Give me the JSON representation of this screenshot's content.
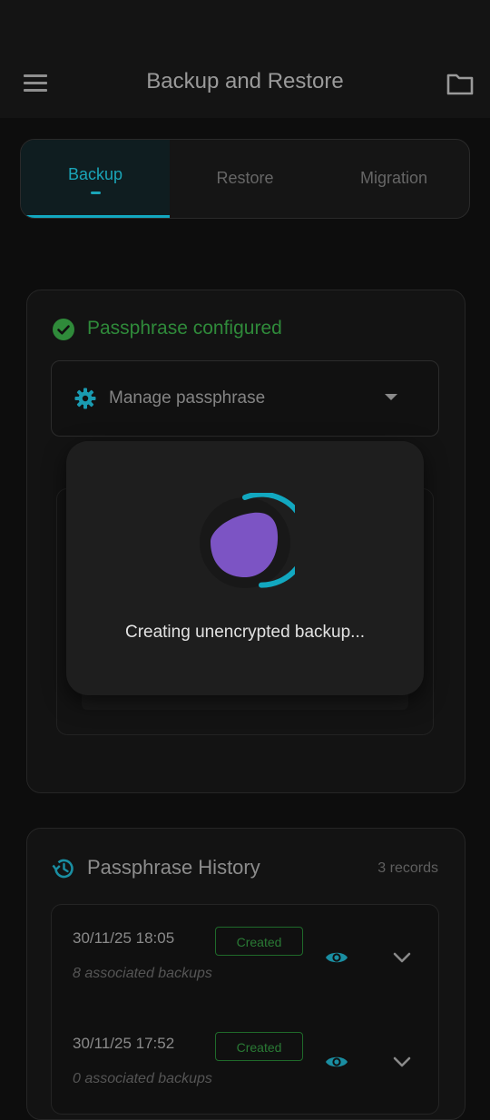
{
  "header": {
    "title": "Backup and Restore",
    "menu_icon": "menu-icon",
    "folder_icon": "folder-icon"
  },
  "tabs": [
    {
      "label": "Backup",
      "active": true
    },
    {
      "label": "Restore",
      "active": false
    },
    {
      "label": "Migration",
      "active": false
    }
  ],
  "passphrase": {
    "status": "Passphrase configured",
    "status_color": "#2f8a3a",
    "manage_label": "Manage passphrase"
  },
  "dialog": {
    "message": "Creating unencrypted backup...",
    "spinner_color": "#12a8c0",
    "logo_color": "#7c54c4"
  },
  "history": {
    "title": "Passphrase History",
    "records": "3 records",
    "items": [
      {
        "date": "30/11/25 18:05",
        "badge": "Created",
        "associated": "8 associated backups"
      },
      {
        "date": "30/11/25 17:52",
        "badge": "Created",
        "associated": "0 associated backups"
      }
    ]
  },
  "colors": {
    "accent": "#1aa5b8",
    "success": "#2f8a3a",
    "background": "#0d0d0d"
  }
}
